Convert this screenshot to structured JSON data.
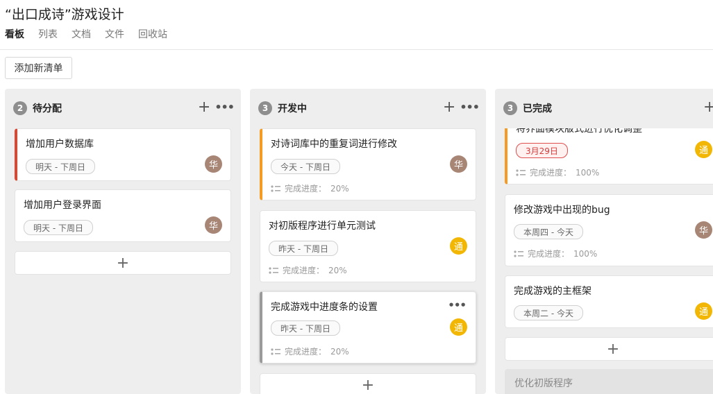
{
  "header": {
    "title": "“出口成诗”游戏设计",
    "tabs": [
      "看板",
      "列表",
      "文档",
      "文件",
      "回收站"
    ]
  },
  "add_list_label": "添加新清单",
  "add_icon": "+",
  "more_icon": "•••",
  "columns": [
    {
      "count": "2",
      "title": "待分配",
      "cards": [
        {
          "title": "增加用户数据库",
          "date": "明天 - 下周日",
          "avatar": "华"
        },
        {
          "title": "增加用户登录界面",
          "date": "明天 - 下周日",
          "avatar": "华"
        }
      ]
    },
    {
      "count": "3",
      "title": "开发中",
      "cards": [
        {
          "title": "对诗词库中的重复词进行修改",
          "date": "今天 - 下周日",
          "avatar": "华",
          "progress_label": "完成进度：",
          "progress": "20%"
        },
        {
          "title": "对初版程序进行单元测试",
          "date": "昨天 - 下周日",
          "avatar": "通",
          "progress_label": "完成进度：",
          "progress": "20%"
        },
        {
          "title": "完成游戏中进度条的设置",
          "date": "昨天 - 下周日",
          "avatar": "通",
          "progress_label": "完成进度：",
          "progress": "20%"
        }
      ]
    },
    {
      "count": "3",
      "title": "已完成",
      "cards": [
        {
          "title": "将界面模块版式进行优化调整",
          "date": "3月29日",
          "avatar": "通",
          "progress_label": "完成进度：",
          "progress": "100%"
        },
        {
          "title": "修改游戏中出现的bug",
          "date": "本周四 - 今天",
          "avatar": "华",
          "progress_label": "完成进度：",
          "progress": "100%"
        },
        {
          "title": "完成游戏的主框架",
          "date": "本周二 - 今天",
          "avatar": "通"
        }
      ],
      "ghost_card": "优化初版程序"
    }
  ]
}
